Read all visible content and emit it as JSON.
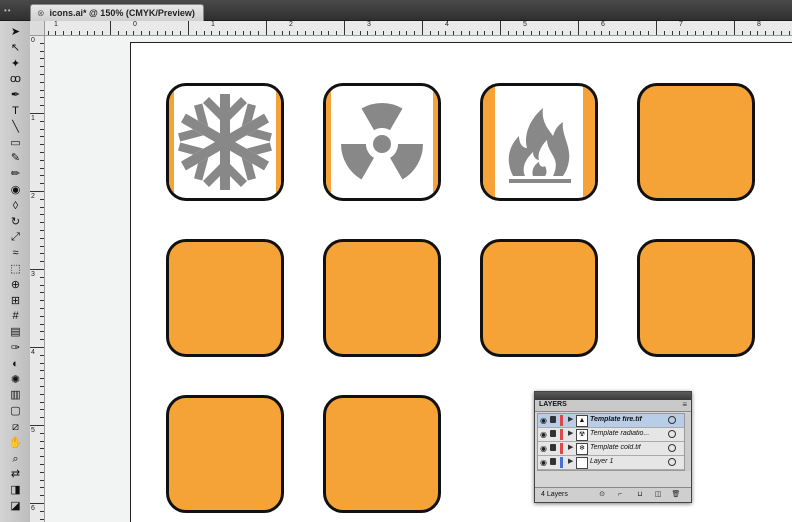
{
  "window": {
    "document_tab": "icons.ai* @ 150% (CMYK/Preview)"
  },
  "rulers": {
    "top_numbers": [
      "1",
      "0",
      "1",
      "2",
      "3",
      "4",
      "5",
      "6",
      "7",
      "8"
    ],
    "left_numbers": [
      "0",
      "1",
      "2",
      "3",
      "4",
      "5",
      "6"
    ]
  },
  "tools": [
    "selection-tool",
    "direct-selection-tool",
    "magic-wand-tool",
    "lasso-tool",
    "pen-tool",
    "type-tool",
    "line-tool",
    "rectangle-tool",
    "paintbrush-tool",
    "pencil-tool",
    "blob-brush-tool",
    "eraser-tool",
    "rotate-tool",
    "scale-tool",
    "warp-tool",
    "free-transform-tool",
    "shape-builder-tool",
    "perspective-grid-tool",
    "mesh-tool",
    "gradient-tool",
    "eyedropper-tool",
    "blend-tool",
    "symbol-sprayer-tool",
    "column-graph-tool",
    "artboard-tool",
    "slice-tool",
    "hand-tool",
    "zoom-tool",
    "swap-colors",
    "fill-stroke-swatches",
    "drawing-mode"
  ],
  "artwork": {
    "tile_color": "#f5a236",
    "icon_color": "#888888",
    "tiles": [
      {
        "id": "snowflake",
        "template": true
      },
      {
        "id": "radiation",
        "template": true
      },
      {
        "id": "fire",
        "template": true
      },
      {
        "id": "blank-1",
        "template": false
      },
      {
        "id": "blank-2",
        "template": false
      },
      {
        "id": "blank-3",
        "template": false
      },
      {
        "id": "blank-4",
        "template": false
      },
      {
        "id": "blank-5",
        "template": false
      },
      {
        "id": "blank-6",
        "template": false
      },
      {
        "id": "blank-7",
        "template": false
      }
    ]
  },
  "layers_panel": {
    "tab": "LAYERS",
    "menu_icon": "panel-menu-icon",
    "layers": [
      {
        "name": "Template fire.tif",
        "thumb": "▲",
        "color": "#e04848",
        "selected": true
      },
      {
        "name": "Template radiatio...",
        "thumb": "☢",
        "color": "#e04848",
        "selected": false
      },
      {
        "name": "Template cold.tif",
        "thumb": "❄",
        "color": "#e04848",
        "selected": false
      },
      {
        "name": "Layer 1",
        "thumb": "",
        "color": "#4a6fd6",
        "selected": false
      }
    ],
    "count": "4 Layers"
  }
}
